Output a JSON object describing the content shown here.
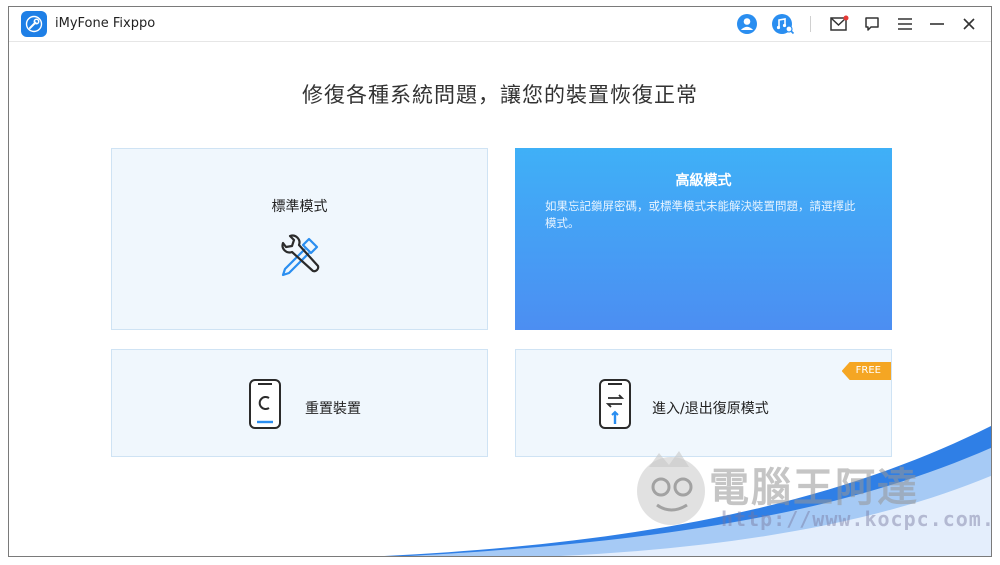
{
  "app": {
    "title": "iMyFone Fixppo",
    "icon": "wrench-icon",
    "accent": "#1e7fe6"
  },
  "toolbar": {
    "buttons": [
      {
        "name": "account-icon"
      },
      {
        "name": "music-search-icon"
      },
      {
        "name": "mail-icon"
      },
      {
        "name": "feedback-icon"
      },
      {
        "name": "menu-icon"
      },
      {
        "name": "minimize-icon"
      },
      {
        "name": "close-icon"
      }
    ]
  },
  "main": {
    "headline": "修復各種系統問題，讓您的裝置恢復正常",
    "standard_mode": {
      "label": "標準模式",
      "icon": "tools-icon"
    },
    "advanced_mode": {
      "title": "高級模式",
      "description": "如果忘記鎖屏密碼，或標準模式未能解決裝置問題，請選擇此模式。",
      "gradient_top": "#3fb0f7",
      "gradient_bottom": "#4c8ef2"
    },
    "reset_device": {
      "label": "重置裝置",
      "icon": "phone-reset-icon"
    },
    "recovery_mode": {
      "label": "進入/退出復原模式",
      "badge": "FREE",
      "icon": "phone-recovery-icon",
      "badge_color": "#f5a623"
    }
  },
  "watermark": {
    "title": "電腦王阿達",
    "url": "http://www.kocpc.com.tw"
  }
}
